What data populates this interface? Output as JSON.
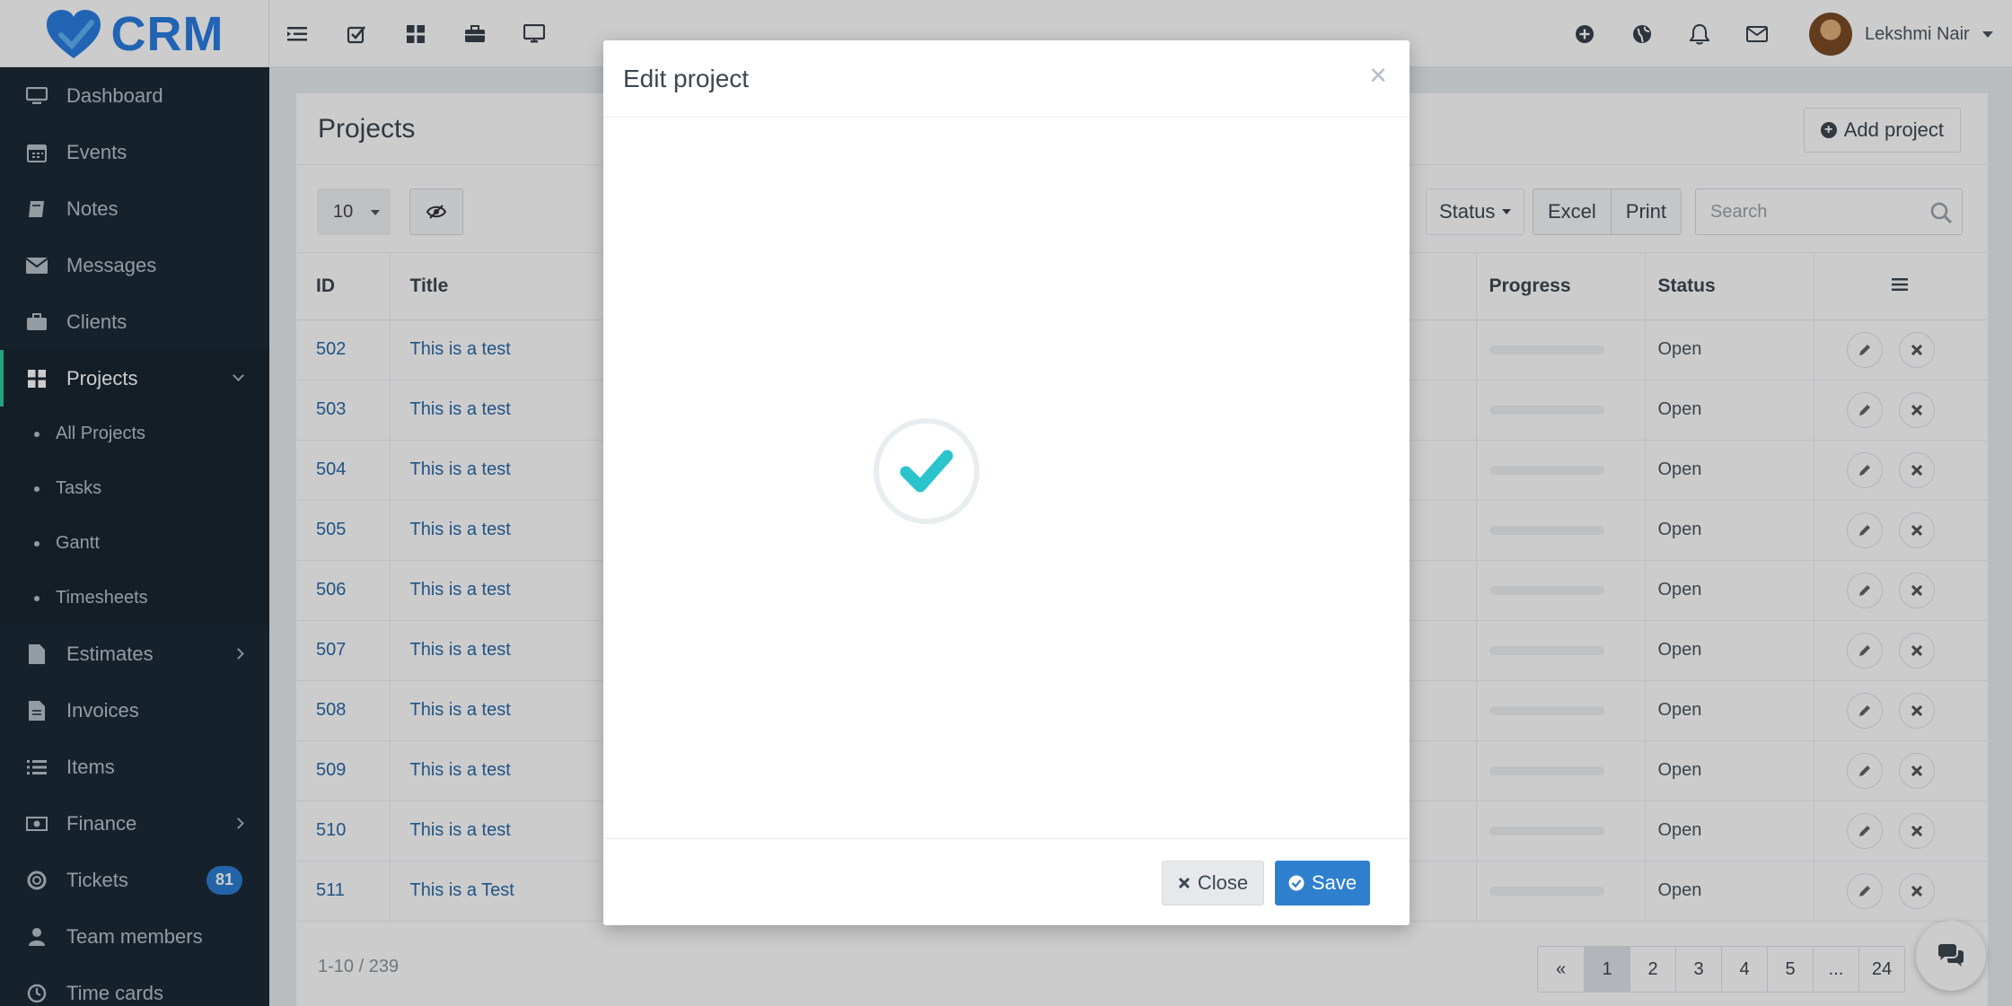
{
  "app": {
    "name": "CRM"
  },
  "header": {
    "user_name": "Lekshmi Nair",
    "left_icons": [
      "menu-collapse-icon",
      "checkbox-icon",
      "grid-icon",
      "briefcase-icon",
      "monitor-icon"
    ],
    "right_icons": [
      "plus-circle-icon",
      "globe-icon",
      "bell-icon",
      "envelope-icon"
    ]
  },
  "sidebar": {
    "items": [
      {
        "label": "Dashboard",
        "icon": "monitor-icon"
      },
      {
        "label": "Events",
        "icon": "calendar-icon"
      },
      {
        "label": "Notes",
        "icon": "book-icon"
      },
      {
        "label": "Messages",
        "icon": "envelope-icon"
      },
      {
        "label": "Clients",
        "icon": "briefcase-icon"
      },
      {
        "label": "Projects",
        "icon": "grid-icon"
      },
      {
        "label": "Estimates",
        "icon": "file-icon"
      },
      {
        "label": "Invoices",
        "icon": "file-text-icon"
      },
      {
        "label": "Items",
        "icon": "list-icon"
      },
      {
        "label": "Finance",
        "icon": "money-icon"
      },
      {
        "label": "Tickets",
        "icon": "lifebuoy-icon",
        "badge": "81"
      },
      {
        "label": "Team members",
        "icon": "user-icon"
      },
      {
        "label": "Time cards",
        "icon": "clock-icon"
      }
    ],
    "projects_submenu": [
      "All Projects",
      "Tasks",
      "Gantt",
      "Timesheets"
    ]
  },
  "page": {
    "title": "Projects",
    "add_button": "Add project",
    "page_size": "10",
    "status_filter": "Status",
    "export_buttons": [
      "Excel",
      "Print"
    ],
    "search_placeholder": "Search"
  },
  "table": {
    "columns": {
      "id": "ID",
      "title": "Title",
      "progress": "Progress",
      "status": "Status"
    },
    "rows": [
      {
        "id": "502",
        "title": "This is a test",
        "progress": 0,
        "status": "Open"
      },
      {
        "id": "503",
        "title": "This is a test",
        "progress": 0,
        "status": "Open"
      },
      {
        "id": "504",
        "title": "This is a test",
        "progress": 0,
        "status": "Open"
      },
      {
        "id": "505",
        "title": "This is a test",
        "progress": 0,
        "status": "Open"
      },
      {
        "id": "506",
        "title": "This is a test",
        "progress": 0,
        "status": "Open"
      },
      {
        "id": "507",
        "title": "This is a test",
        "progress": 0,
        "status": "Open"
      },
      {
        "id": "508",
        "title": "This is a test",
        "progress": 0,
        "status": "Open"
      },
      {
        "id": "509",
        "title": "This is a test",
        "progress": 0,
        "status": "Open"
      },
      {
        "id": "510",
        "title": "This is a test",
        "progress": 0,
        "status": "Open"
      },
      {
        "id": "511",
        "title": "This is a Test",
        "progress": 0,
        "status": "Open"
      }
    ]
  },
  "footer": {
    "info": "1-10 / 239",
    "pages": [
      "«",
      "1",
      "2",
      "3",
      "4",
      "5",
      "...",
      "24"
    ],
    "current_page": "1"
  },
  "modal": {
    "title": "Edit project",
    "close_label": "Close",
    "save_label": "Save"
  },
  "colors": {
    "sidebar_bg": "#1c2b36",
    "active_accent": "#2ecc9f",
    "primary": "#2f7fcf",
    "brand": "#2a7de1",
    "spinner_check": "#2bc4cc",
    "badge": "#2c7dd3"
  }
}
